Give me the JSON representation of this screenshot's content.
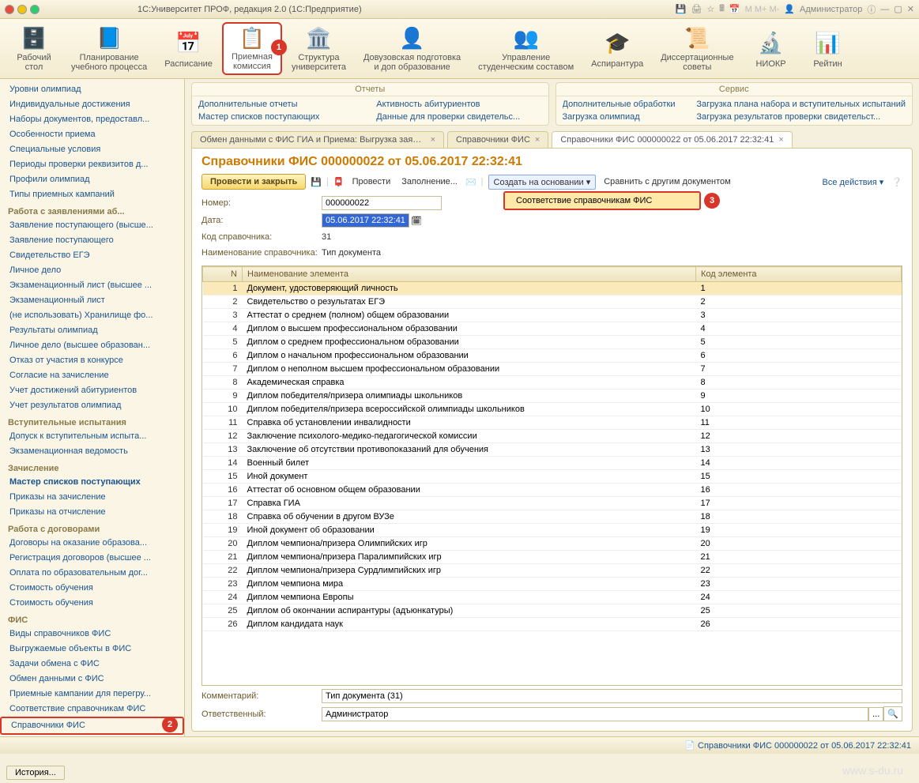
{
  "window": {
    "title": "1С:Университет ПРОФ, редакция 2.0  (1С:Предприятие)",
    "user": "Администратор"
  },
  "toolbar": [
    {
      "label": "Рабочий\nстол",
      "icon": "🗄️"
    },
    {
      "label": "Планирование\nучебного процесса",
      "icon": "📘"
    },
    {
      "label": "Расписание",
      "icon": "📅"
    },
    {
      "label": "Приемная\nкомиссия",
      "icon": "📋",
      "active": true,
      "badge": "1"
    },
    {
      "label": "Структура\nуниверситета",
      "icon": "🏛️"
    },
    {
      "label": "Довузовская подготовка\nи доп образование",
      "icon": "👤"
    },
    {
      "label": "Управление\nстуденческим составом",
      "icon": "👥"
    },
    {
      "label": "Аспирантура",
      "icon": "🎓"
    },
    {
      "label": "Диссертационные\nсоветы",
      "icon": "📜"
    },
    {
      "label": "НИОКР",
      "icon": "🔬"
    },
    {
      "label": "Рейтин",
      "icon": "📊"
    }
  ],
  "sidebar": {
    "top": [
      "Уровни олимпиад",
      "Индивидуальные достижения",
      "Наборы документов, предоставл...",
      "Особенности приема",
      "Специальные условия",
      "Периоды проверки реквизитов д...",
      "Профили олимпиад",
      "Типы приемных кампаний"
    ],
    "grp1": {
      "title": "Работа с заявлениями аб...",
      "items": [
        "Заявление поступающего (высше...",
        "Заявление поступающего",
        "Свидетельство ЕГЭ",
        "Личное дело",
        "Экзаменационный лист (высшее ...",
        "Экзаменационный лист",
        "(не использовать) Хранилище фо...",
        "Результаты олимпиад",
        "Личное дело (высшее образован...",
        "Отказ от участия в конкурсе",
        "Согласие на зачисление",
        "Учет достижений абитуриентов",
        "Учет результатов олимпиад"
      ]
    },
    "grp2": {
      "title": "Вступительные испытания",
      "items": [
        "Допуск к вступительным испыта...",
        "Экзаменационная ведомость"
      ]
    },
    "grp3": {
      "title": "Зачисление",
      "items": [
        "Мастер списков поступающих",
        "Приказы на зачисление",
        "Приказы на отчисление"
      ]
    },
    "grp4": {
      "title": "Работа с договорами",
      "items": [
        "Договоры на оказание образова...",
        "Регистрация договоров (высшее ...",
        "Оплата по образовательным дог...",
        "Стоимость обучения",
        "Стоимость обучения"
      ]
    },
    "grp5": {
      "title": "ФИС",
      "items": [
        "Виды справочников ФИС",
        "Выгружаемые объекты в ФИС",
        "Задачи обмена с ФИС",
        "Обмен данными с ФИС",
        "Приемные кампании для перегру...",
        "Соответствие справочникам ФИС",
        "Справочники ФИС"
      ]
    }
  },
  "panels": {
    "left": {
      "title": "Отчеты",
      "col1": [
        "Дополнительные отчеты",
        "Мастер списков поступающих"
      ],
      "col2": [
        "Активность абитуриентов",
        "Данные для проверки свидетельс..."
      ]
    },
    "right": {
      "title": "Сервис",
      "col1": [
        "Дополнительные обработки",
        "Загрузка олимпиад"
      ],
      "col2": [
        "Загрузка плана набора и вступительных испытаний",
        "Загрузка результатов проверки свидетельст..."
      ]
    }
  },
  "tabs": [
    {
      "label": "Обмен данными с ФИС ГИА и Приема: Выгрузка заявлений абиту..."
    },
    {
      "label": "Справочники ФИС"
    },
    {
      "label": "Справочники ФИС 000000022 от 05.06.2017 22:32:41",
      "active": true
    }
  ],
  "doc": {
    "title": "Справочники ФИС 000000022 от 05.06.2017 22:32:41",
    "btn_primary": "Провести и закрыть",
    "btn_post": "Провести",
    "btn_fill": "Заполнение...",
    "btn_create": "Создать на основании",
    "btn_compare": "Сравнить с другим документом",
    "all_actions": "Все действия",
    "dropdown_item": "Соответствие справочникам ФИС",
    "num_label": "Номер:",
    "num": "000000022",
    "date_label": "Дата:",
    "date": "05.06.2017 22:32:41",
    "code_label": "Код справочника:",
    "code": "31",
    "name_label": "Наименование справочника:",
    "name": "Тип документа",
    "th_n": "N",
    "th_name": "Наименование элемента",
    "th_code": "Код элемента",
    "rows": [
      {
        "n": 1,
        "name": "Документ, удостоверяющий личность",
        "code": "1"
      },
      {
        "n": 2,
        "name": "Свидетельство о результатах ЕГЭ",
        "code": "2"
      },
      {
        "n": 3,
        "name": "Аттестат о среднем (полном) общем образовании",
        "code": "3"
      },
      {
        "n": 4,
        "name": "Диплом о высшем профессиональном образовании",
        "code": "4"
      },
      {
        "n": 5,
        "name": "Диплом о среднем профессиональном образовании",
        "code": "5"
      },
      {
        "n": 6,
        "name": "Диплом о начальном профессиональном образовании",
        "code": "6"
      },
      {
        "n": 7,
        "name": "Диплом о неполном высшем профессиональном образовании",
        "code": "7"
      },
      {
        "n": 8,
        "name": "Академическая справка",
        "code": "8"
      },
      {
        "n": 9,
        "name": "Диплом победителя/призера олимпиады школьников",
        "code": "9"
      },
      {
        "n": 10,
        "name": "Диплом победителя/призера всероссийской олимпиады школьников",
        "code": "10"
      },
      {
        "n": 11,
        "name": "Справка об установлении инвалидности",
        "code": "11"
      },
      {
        "n": 12,
        "name": "Заключение психолого-медико-педагогической комиссии",
        "code": "12"
      },
      {
        "n": 13,
        "name": "Заключение об отсутствии противопоказаний для обучения",
        "code": "13"
      },
      {
        "n": 14,
        "name": "Военный билет",
        "code": "14"
      },
      {
        "n": 15,
        "name": "Иной документ",
        "code": "15"
      },
      {
        "n": 16,
        "name": "Аттестат об основном общем образовании",
        "code": "16"
      },
      {
        "n": 17,
        "name": "Справка ГИА",
        "code": "17"
      },
      {
        "n": 18,
        "name": "Справка об обучении в другом ВУЗе",
        "code": "18"
      },
      {
        "n": 19,
        "name": "Иной документ об образовании",
        "code": "19"
      },
      {
        "n": 20,
        "name": "Диплом чемпиона/призера Олимпийских игр",
        "code": "20"
      },
      {
        "n": 21,
        "name": "Диплом чемпиона/призера Паралимпийских игр",
        "code": "21"
      },
      {
        "n": 22,
        "name": "Диплом чемпиона/призера Сурдлимпийских игр",
        "code": "22"
      },
      {
        "n": 23,
        "name": "Диплом чемпиона мира",
        "code": "23"
      },
      {
        "n": 24,
        "name": "Диплом чемпиона Европы",
        "code": "24"
      },
      {
        "n": 25,
        "name": "Диплом об окончании аспирантуры (адъюнкатуры)",
        "code": "25"
      },
      {
        "n": 26,
        "name": "Диплом кандидата наук",
        "code": "26"
      }
    ],
    "comment_label": "Комментарий:",
    "comment": "Тип документа (31)",
    "resp_label": "Ответственный:",
    "resp": "Администратор"
  },
  "status": {
    "link": "Справочники ФИС 000000022 от 05.06.2017 22:32:41",
    "history": "История..."
  },
  "badges": {
    "b2": "2",
    "b3": "3"
  }
}
